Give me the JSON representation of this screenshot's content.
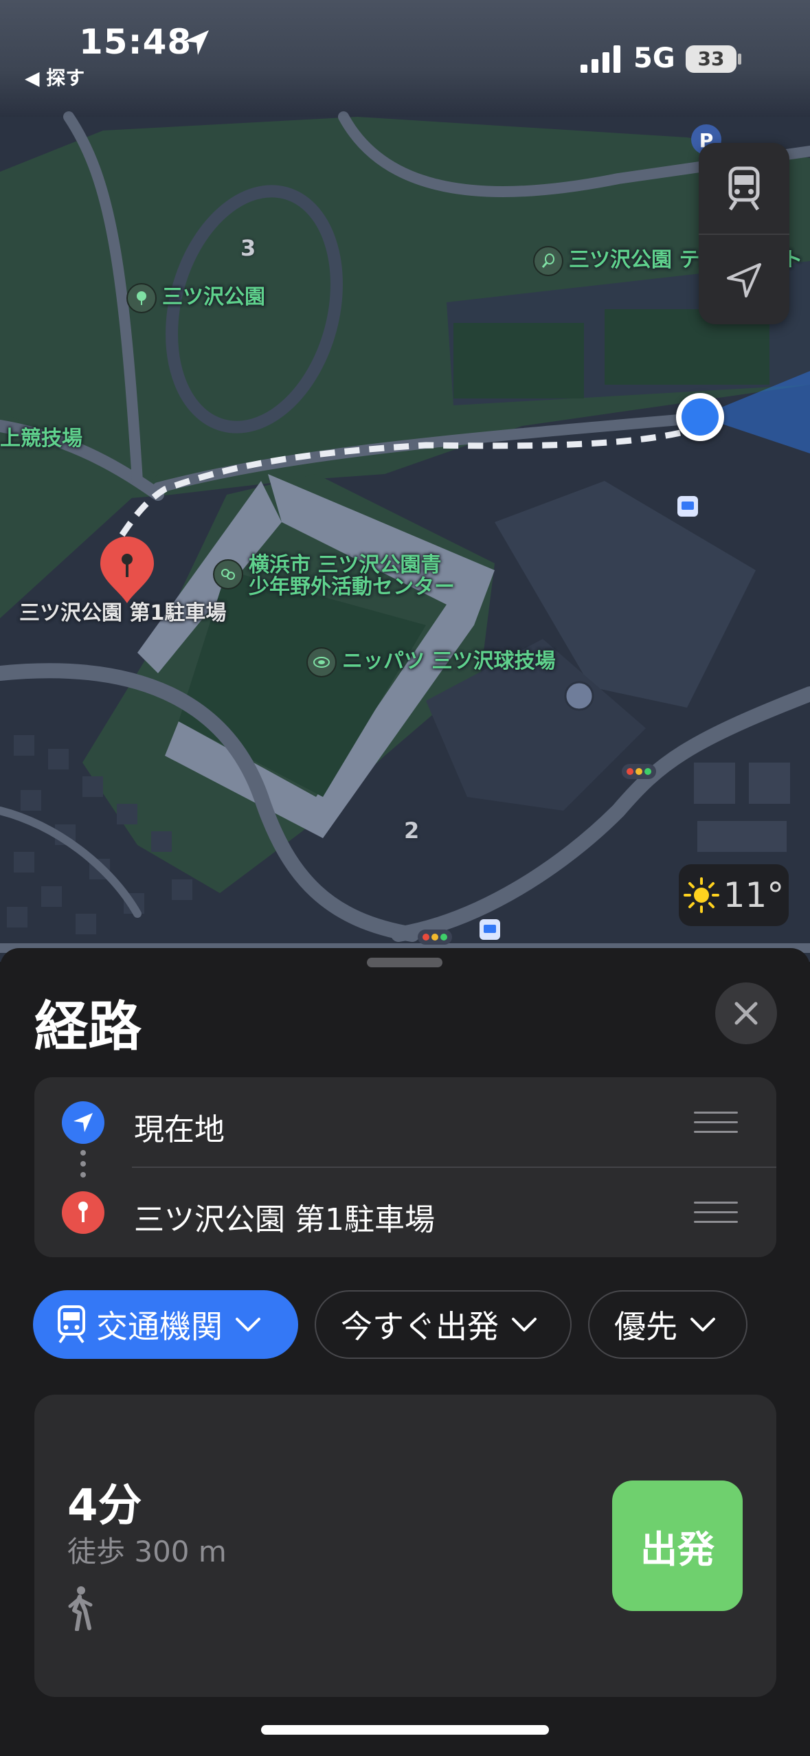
{
  "status_bar": {
    "time": "15:48",
    "back_app": "◀ 探す",
    "network": "5G",
    "battery": "33"
  },
  "map": {
    "labels": {
      "park": "三ツ沢公園",
      "tennis": "三ツ沢公園 テニスコート",
      "athletics": "上競技場",
      "destination_pin": "三ツ沢公園 第1駐車場",
      "youth_center_line1": "横浜市 三ツ沢公園青",
      "youth_center_line2": "少年野外活動センター",
      "ballpark": "ニッパツ 三ツ沢球技場",
      "block_3": "3",
      "block_2": "2"
    },
    "weather": {
      "temperature": "11°"
    }
  },
  "sheet": {
    "title": "経路",
    "route": {
      "origin": "現在地",
      "destination": "三ツ沢公園 第1駐車場"
    },
    "chips": {
      "transit": "交通機関",
      "depart": "今すぐ出発",
      "prefs": "優先"
    },
    "result": {
      "eta": "4分",
      "detail": "徒歩 300 m",
      "go_label": "出発"
    }
  },
  "colors": {
    "accent": "#3478f6",
    "go": "#6fd06e",
    "pin": "#e8504a",
    "park_text": "#5fd28d"
  }
}
